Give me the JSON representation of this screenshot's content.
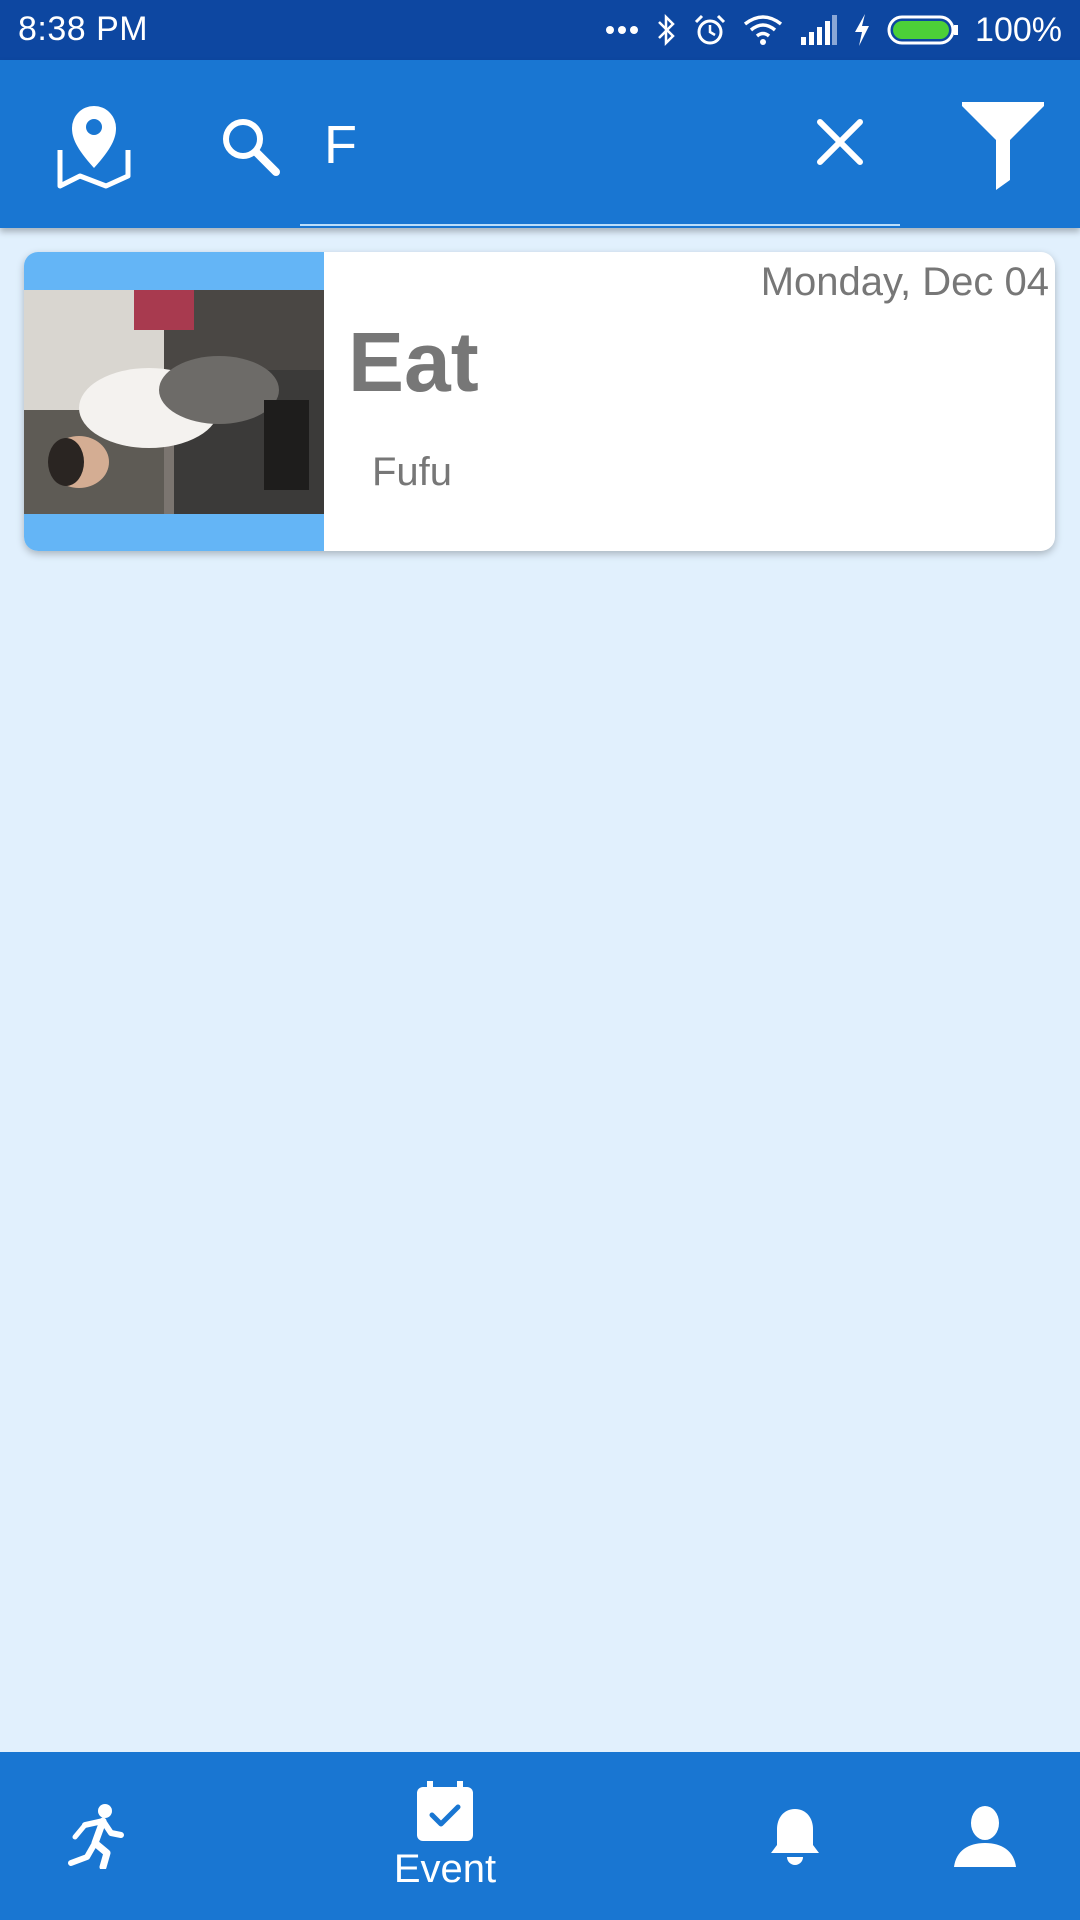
{
  "status_bar": {
    "time": "8:38  PM",
    "battery": "100%",
    "icons": [
      "more-dots-icon",
      "bluetooth-icon",
      "alarm-icon",
      "wifi-icon",
      "signal-icon",
      "charging-icon",
      "battery-icon"
    ]
  },
  "app_bar": {
    "search_value": "F",
    "icons": {
      "map": "map-pin-icon",
      "search": "search-icon",
      "clear": "close-icon",
      "filter": "filter-icon"
    }
  },
  "events": [
    {
      "date": "Monday, Dec 04",
      "title": "Eat",
      "subtitle": "Fufu"
    }
  ],
  "bottom_nav": {
    "items": [
      {
        "icon": "running-icon",
        "label": ""
      },
      {
        "icon": "calendar-check-icon",
        "label": "Event",
        "active": true
      },
      {
        "icon": "bell-icon",
        "label": ""
      },
      {
        "icon": "person-icon",
        "label": ""
      }
    ]
  },
  "colors": {
    "status_bar": "#0D47A1",
    "primary": "#1976D2",
    "background": "#E1F0FD",
    "thumb_bg": "#64B5F6",
    "card_text": "#777777"
  }
}
